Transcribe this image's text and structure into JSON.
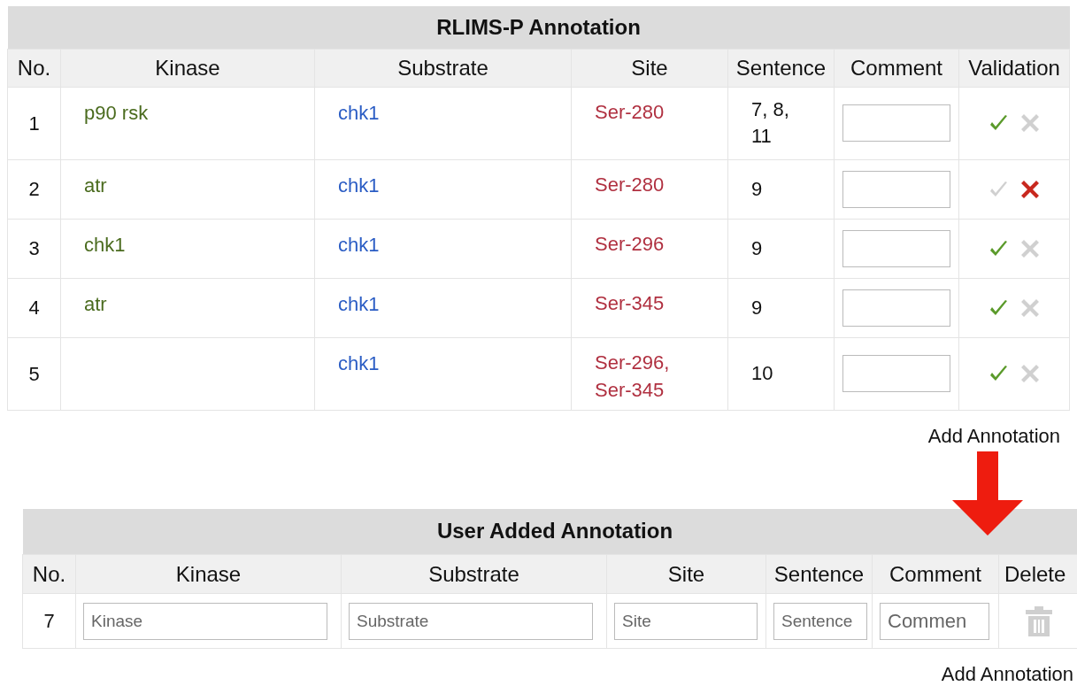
{
  "rlims_table": {
    "title": "RLIMS-P Annotation",
    "columns": [
      "No.",
      "Kinase",
      "Substrate",
      "Site",
      "Sentence",
      "Comment",
      "Validation"
    ],
    "rows": [
      {
        "no": "1",
        "kinase": "p90 rsk",
        "substrate": "chk1",
        "site": "Ser-280",
        "sentence": "7, 8, 11",
        "accepted": true,
        "rejected": false
      },
      {
        "no": "2",
        "kinase": "atr",
        "substrate": "chk1",
        "site": "Ser-280",
        "sentence": "9",
        "accepted": false,
        "rejected": true
      },
      {
        "no": "3",
        "kinase": "chk1",
        "substrate": "chk1",
        "site": "Ser-296",
        "sentence": "9",
        "accepted": true,
        "rejected": false
      },
      {
        "no": "4",
        "kinase": "atr",
        "substrate": "chk1",
        "site": "Ser-345",
        "sentence": "9",
        "accepted": true,
        "rejected": false
      },
      {
        "no": "5",
        "substrate": "chk1",
        "site": "Ser-296, Ser-345",
        "sentence": "10",
        "accepted": true,
        "rejected": false
      }
    ],
    "add_link": "Add Annotation"
  },
  "user_table": {
    "title": "User Added Annotation",
    "columns": [
      "No.",
      "Kinase",
      "Substrate",
      "Site",
      "Sentence",
      "Comment",
      "Delete"
    ],
    "rows": [
      {
        "no": "7",
        "placeholders": [
          "Kinase",
          "Substrate",
          "Site",
          "Sentence",
          "Commen"
        ]
      }
    ],
    "add_link": "Add Annotation"
  }
}
